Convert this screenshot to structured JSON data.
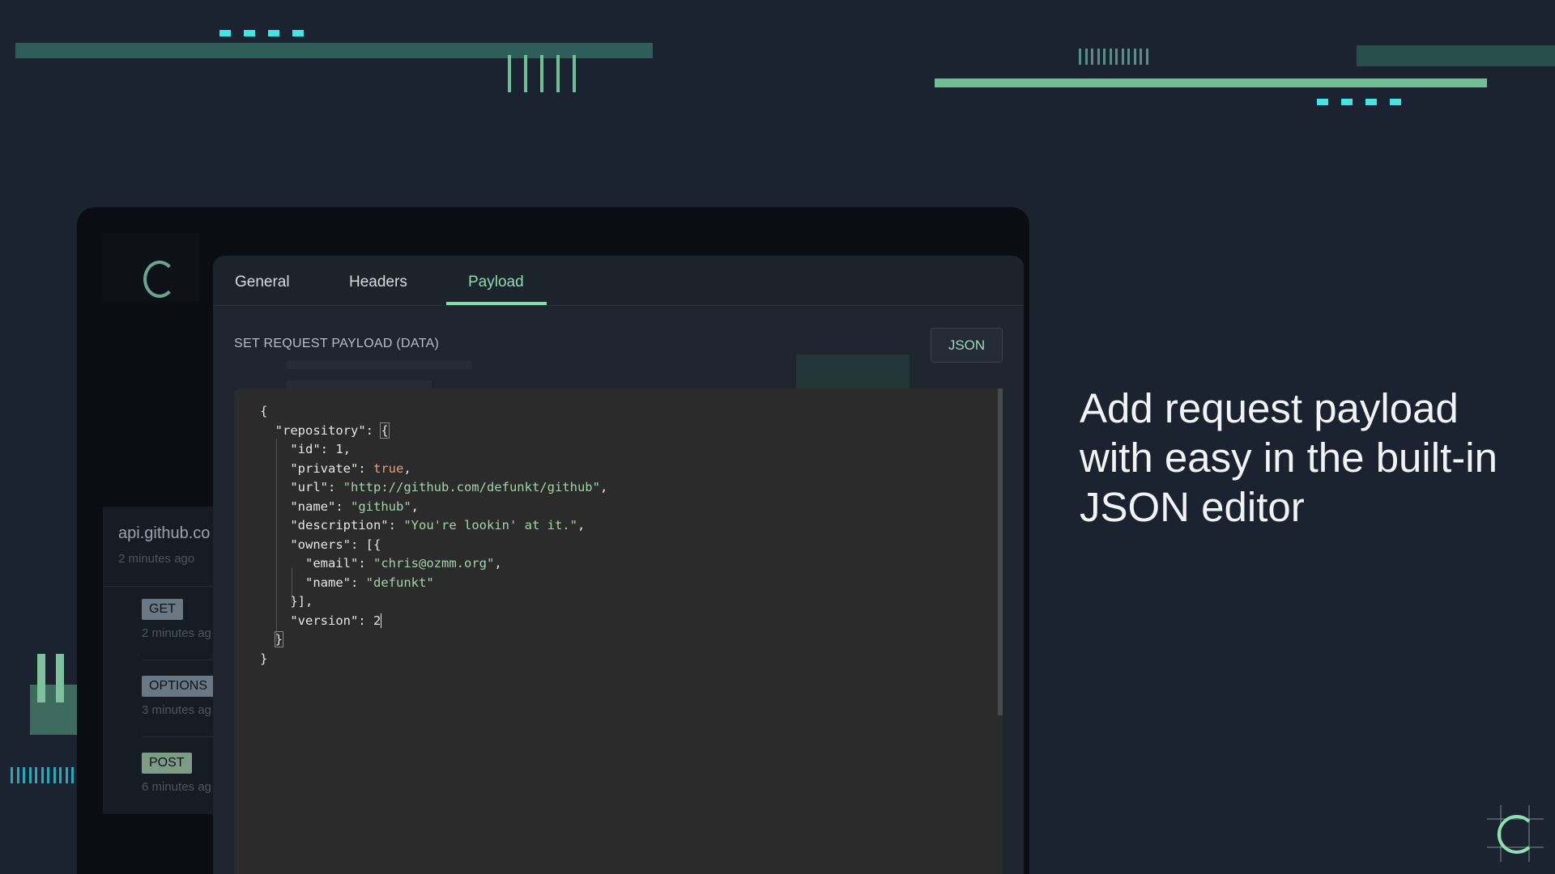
{
  "dialog": {
    "tabs": [
      {
        "label": "General",
        "active": false
      },
      {
        "label": "Headers",
        "active": false
      },
      {
        "label": "Payload",
        "active": true
      }
    ],
    "payload_label": "SET REQUEST PAYLOAD (DATA)",
    "format_button": "JSON"
  },
  "editor": {
    "lines": [
      "{",
      "  \"repository\": {",
      "    \"id\": 1,",
      "    \"private\": true,",
      "    \"url\": \"http://github.com/defunkt/github\",",
      "    \"name\": \"github\",",
      "    \"description\": \"You're lookin' at it.\",",
      "    \"owners\": [{",
      "      \"email\": \"chris@ozmm.org\",",
      "      \"name\": \"defunkt\"",
      "    }],",
      "    \"version\": 2",
      "  }",
      "}"
    ]
  },
  "history": {
    "host": "api.github.co",
    "host_time": "2 minutes ago",
    "items": [
      {
        "method": "GET",
        "time": "2 minutes ag"
      },
      {
        "method": "OPTIONS",
        "time": "3 minutes ag"
      },
      {
        "method": "POST",
        "time": "6 minutes ag"
      }
    ]
  },
  "headline": "Add request payload with easy in the built-in JSON editor",
  "colors": {
    "background": "#1c2330",
    "accent_green": "#7ee0a6",
    "accent_cyan": "#3ee6e6",
    "editor_bg": "#2b2b2b"
  },
  "icons": [
    "app-logo-icon",
    "corner-logo-icon"
  ]
}
